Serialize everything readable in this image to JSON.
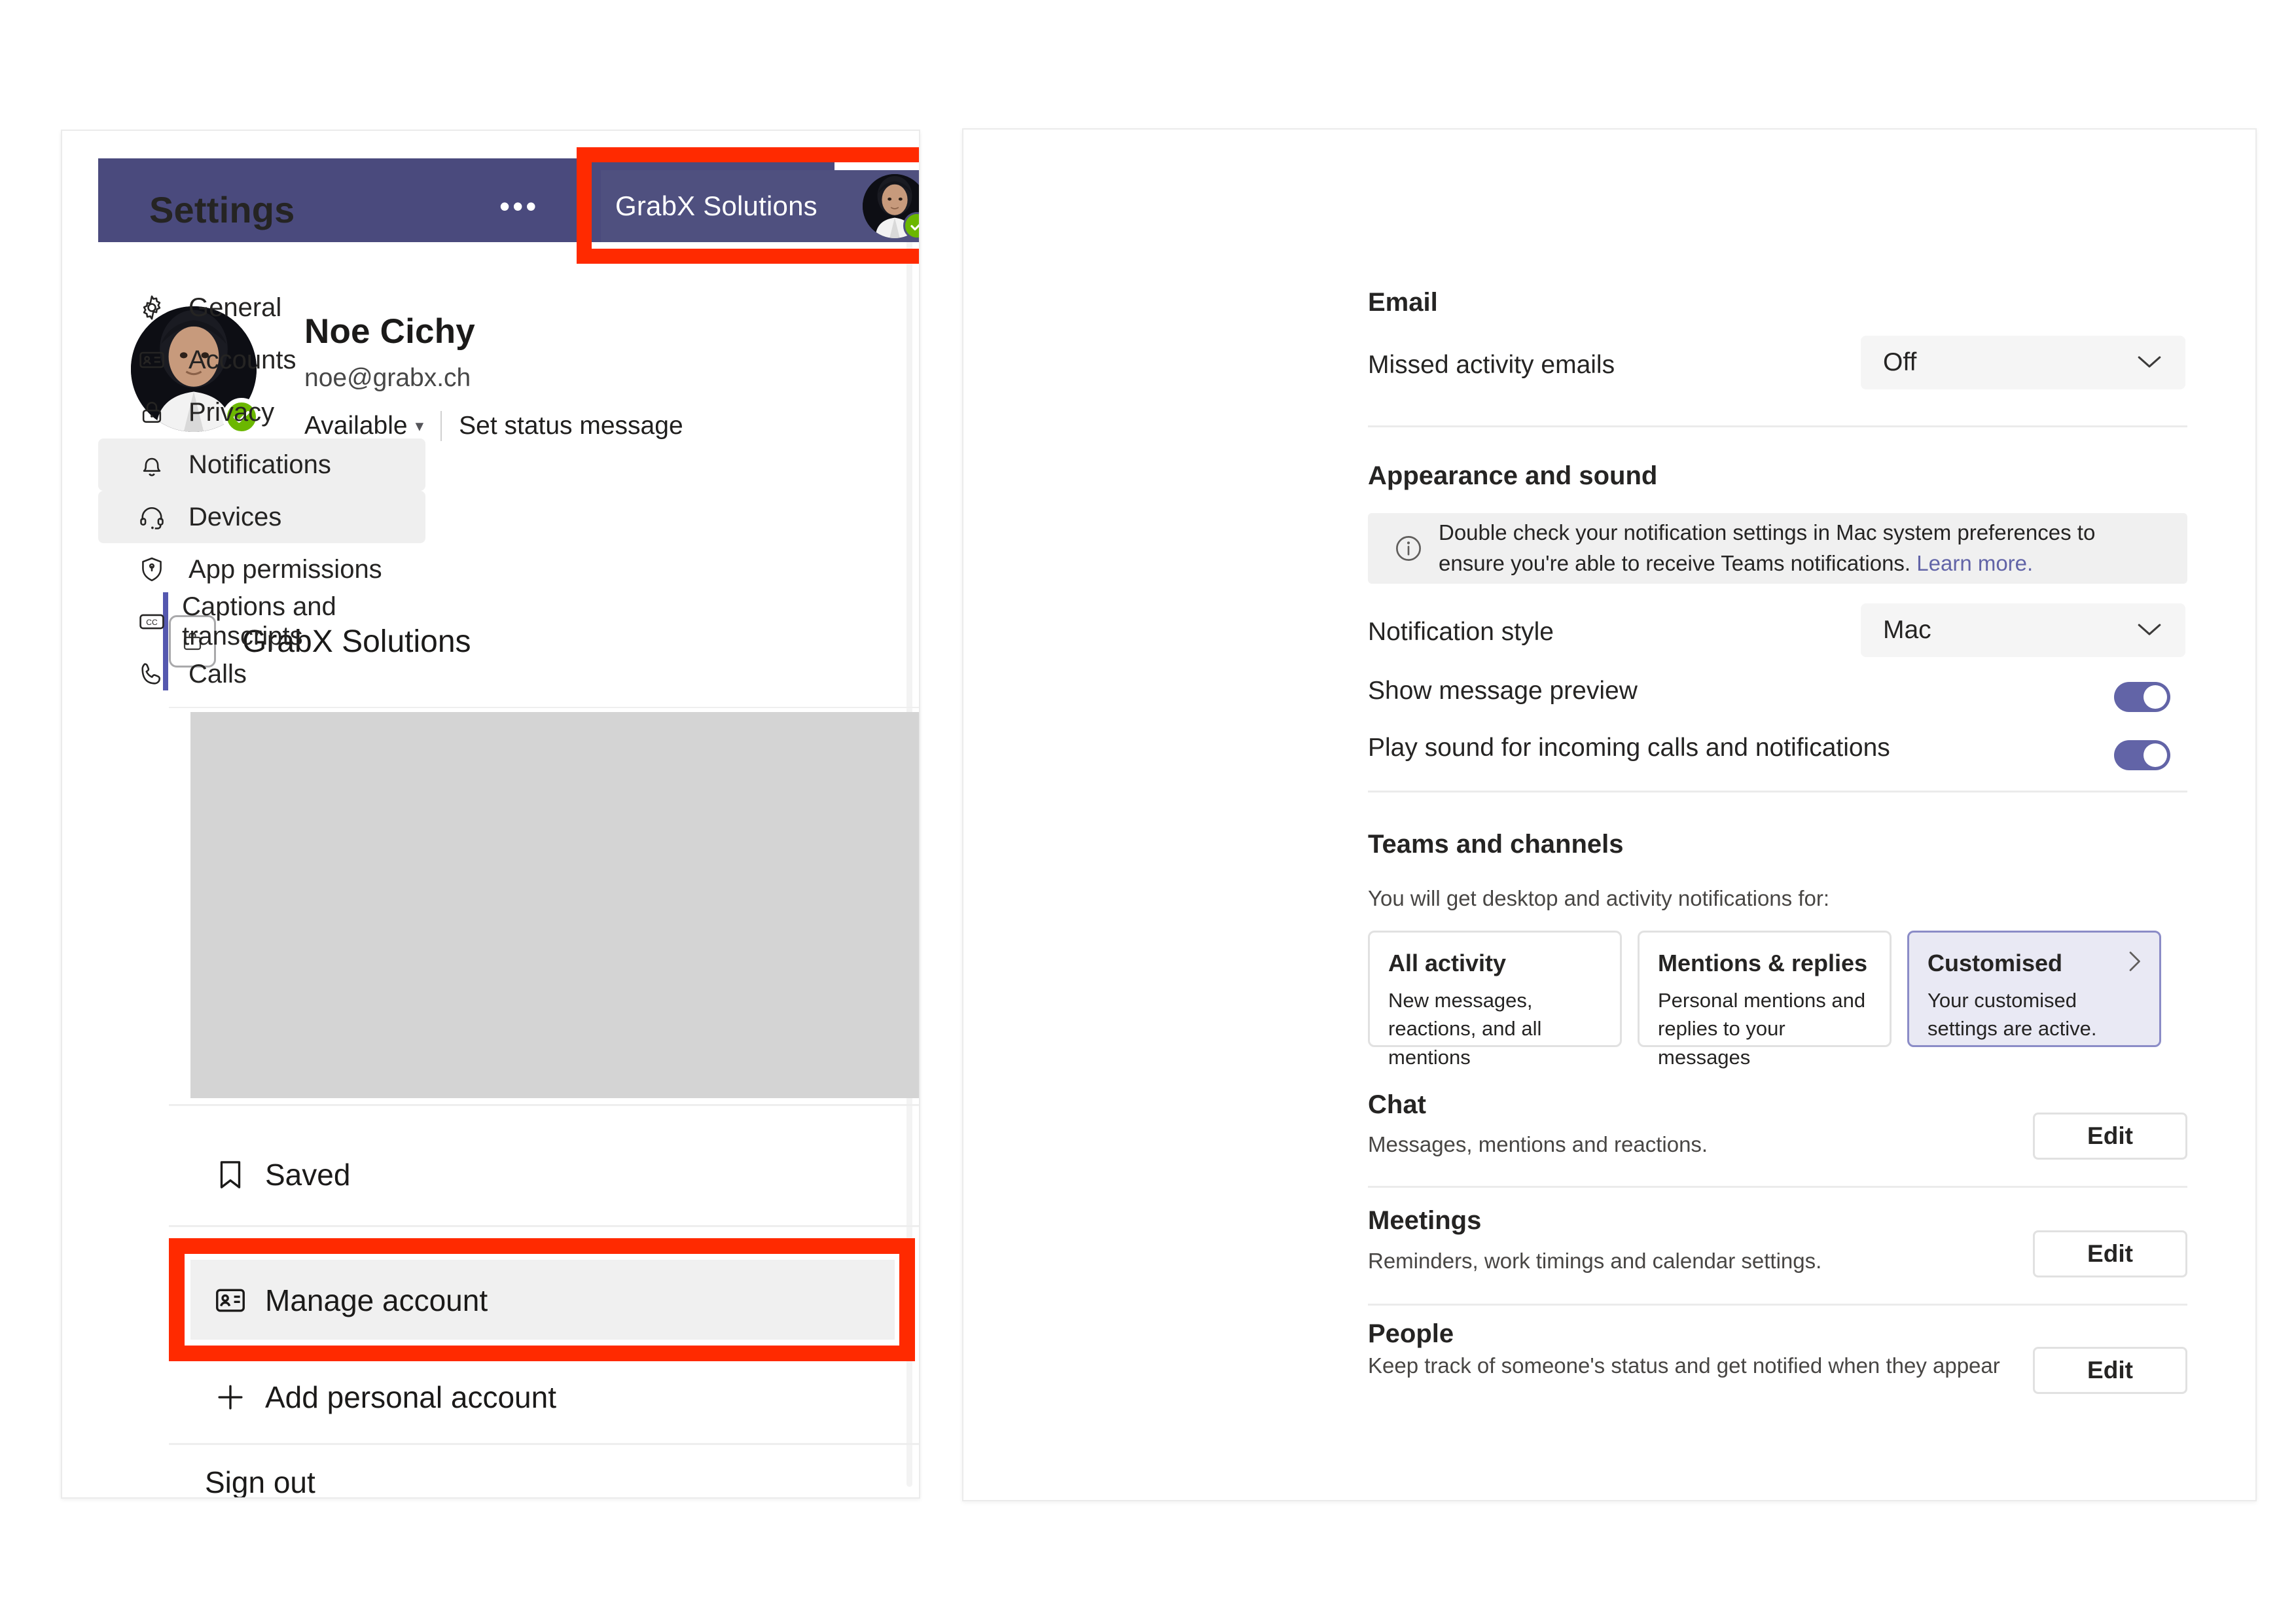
{
  "colors": {
    "teams_purple": "#6264a7",
    "header_bar": "#4a4a7d",
    "highlight_red": "#ff2a00",
    "presence_green": "#6bb700",
    "selected_card_bg": "#e9e9f4"
  },
  "left_panel": {
    "header": {
      "overflow_label": "•••",
      "org_chip_label": "GrabX Solutions",
      "presence": "available"
    },
    "profile": {
      "name": "Noe Cichy",
      "email": "noe@grabx.ch",
      "status": "Available",
      "status_message_action": "Set status message"
    },
    "org": {
      "name": "GrabX Solutions"
    },
    "menu": [
      {
        "label": "Saved",
        "icon": "bookmark-icon"
      },
      {
        "label": "Manage account",
        "icon": "id-card-icon"
      },
      {
        "label": "Add personal account",
        "icon": "plus-icon"
      }
    ],
    "sign_out": "Sign out"
  },
  "right_panel": {
    "title": "Settings",
    "nav": [
      {
        "label": "General",
        "icon": "gear-icon",
        "selected": false
      },
      {
        "label": "Accounts",
        "icon": "id-card-icon",
        "selected": false
      },
      {
        "label": "Privacy",
        "icon": "lock-icon",
        "selected": false
      },
      {
        "label": "Notifications",
        "icon": "bell-icon",
        "selected": true
      },
      {
        "label": "Devices",
        "icon": "headset-icon",
        "selected": true
      },
      {
        "label": "App permissions",
        "icon": "shield-lock-icon",
        "selected": false
      },
      {
        "label": "Captions and transcripts",
        "icon": "cc-icon",
        "selected": false
      },
      {
        "label": "Calls",
        "icon": "phone-icon",
        "selected": false
      }
    ],
    "email": {
      "heading": "Email",
      "missed_activity_label": "Missed activity emails",
      "missed_activity_value": "Off"
    },
    "appearance": {
      "heading": "Appearance and sound",
      "banner_text": "Double check your notification settings in Mac system preferences to ensure you're able to receive Teams notifications. ",
      "banner_link": "Learn more.",
      "notification_style_label": "Notification style",
      "notification_style_value": "Mac",
      "show_message_preview_label": "Show message preview",
      "show_message_preview_on": "on",
      "play_sound_label": "Play sound for incoming calls and notifications",
      "play_sound_on": "on"
    },
    "teams_and_channels": {
      "heading": "Teams and channels",
      "subtitle": "You will get desktop and activity notifications for:",
      "cards": [
        {
          "title": "All activity",
          "desc": "New messages, reactions, and all mentions",
          "active": false
        },
        {
          "title": "Mentions & replies",
          "desc": "Personal mentions and replies to your messages",
          "active": false
        },
        {
          "title": "Customised",
          "desc": "Your customised settings are active.",
          "active": true
        }
      ]
    },
    "sections": [
      {
        "title": "Chat",
        "desc": "Messages, mentions and reactions.",
        "button": "Edit"
      },
      {
        "title": "Meetings",
        "desc": "Reminders, work timings and calendar settings.",
        "button": "Edit"
      },
      {
        "title": "People",
        "desc": "Keep track of someone's status and get notified when they appear",
        "button": "Edit"
      }
    ]
  }
}
